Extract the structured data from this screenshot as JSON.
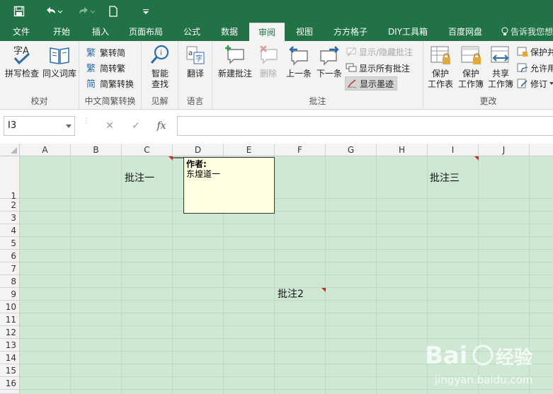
{
  "ribbon_tabs": [
    "文件",
    "开始",
    "插入",
    "页面布局",
    "公式",
    "数据",
    "审阅",
    "视图",
    "方方格子",
    "DIY工具箱",
    "百度网盘"
  ],
  "active_tab": "审阅",
  "tell_me": "告诉我您想",
  "groups": {
    "proofing": {
      "label": "校对",
      "spell": "拼写检查",
      "thesaurus": "同义词库"
    },
    "chinese": {
      "label": "中文简繁转换",
      "t2s": "繁转简",
      "s2t": "简转繁",
      "convert": "简繁转换"
    },
    "insights": {
      "label": "见解",
      "smart_lookup_1": "智能",
      "smart_lookup_2": "查找"
    },
    "language": {
      "label": "语言",
      "translate": "翻译"
    },
    "comments": {
      "label": "批注",
      "new": "新建批注",
      "delete": "删除",
      "prev": "上一条",
      "next": "下一条",
      "show_hide": "显示/隐藏批注",
      "show_all": "显示所有批注",
      "show_ink": "显示墨迹"
    },
    "changes": {
      "label": "更改",
      "protect_sheet_1": "保护",
      "protect_sheet_2": "工作表",
      "protect_wb_1": "保护",
      "protect_wb_2": "工作簿",
      "share_wb_1": "共享",
      "share_wb_2": "工作簿",
      "protect_share": "保护并",
      "allow_users": "允许用",
      "track": "修订"
    }
  },
  "formula_bar": {
    "name_box": "I3",
    "fx": "fx",
    "cancel": "✕",
    "enter": "✓"
  },
  "columns": [
    "A",
    "B",
    "C",
    "D",
    "E",
    "F",
    "G",
    "H",
    "I",
    "J"
  ],
  "rows": [
    "1",
    "2",
    "3",
    "4",
    "5",
    "6",
    "7",
    "8",
    "9",
    "10",
    "11",
    "12",
    "13",
    "14",
    "15",
    "16"
  ],
  "cells": {
    "c1": "批注一",
    "i1": "批注三",
    "f9": "批注2"
  },
  "comment": {
    "author_label": "作者:",
    "text": "东煌道一"
  },
  "watermark": {
    "brand": "Bai",
    "brand2": "经验",
    "url": "jingyan.baidu.com"
  },
  "colors": {
    "excel_green": "#217346",
    "sheet_bg": "#cfe8d4",
    "comment_bg": "#ffffe1",
    "comment_marker": "#e0201f"
  }
}
